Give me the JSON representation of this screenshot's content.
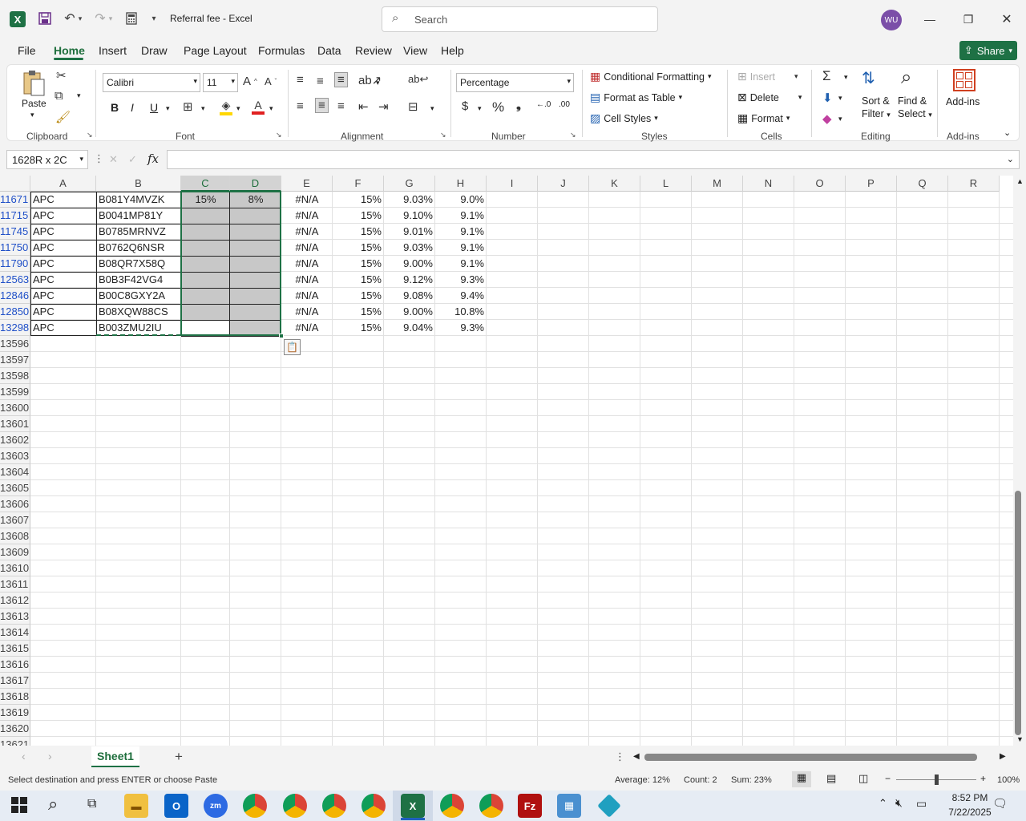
{
  "titlebar": {
    "title": "Referral fee  -  Excel",
    "search_placeholder": "Search",
    "avatar": "WU"
  },
  "tabs": [
    "File",
    "Home",
    "Insert",
    "Draw",
    "Page Layout",
    "Formulas",
    "Data",
    "Review",
    "View",
    "Help"
  ],
  "share_label": "Share",
  "ribbon": {
    "paste": "Paste",
    "clipboard": "Clipboard",
    "font_name": "Calibri",
    "font_size": "11",
    "font": "Font",
    "alignment": "Alignment",
    "number_format": "Percentage",
    "number": "Number",
    "conditional_formatting": "Conditional Formatting",
    "format_as_table": "Format as Table",
    "cell_styles": "Cell Styles",
    "styles": "Styles",
    "insert": "Insert",
    "delete": "Delete",
    "format": "Format",
    "cells": "Cells",
    "sort_filter_1": "Sort &",
    "sort_filter_2": "Filter",
    "find_select_1": "Find &",
    "find_select_2": "Select",
    "editing": "Editing",
    "addins": "Add-ins",
    "addins_group": "Add-ins",
    "bold": "B",
    "italic": "I",
    "underline": "U"
  },
  "formula_bar": {
    "name_box": "1628R x 2C",
    "fx": "fx",
    "value": ""
  },
  "grid": {
    "columns": [
      "A",
      "B",
      "C",
      "D",
      "E",
      "F",
      "G",
      "H",
      "I",
      "J",
      "K",
      "L",
      "M",
      "N",
      "O",
      "P",
      "Q",
      "R"
    ],
    "rows": [
      {
        "num": "11671",
        "a": "APC",
        "b": "B081Y4MVZK",
        "c": "15%",
        "d": "8%",
        "e": "#N/A",
        "f": "15%",
        "g": "9.03%",
        "h": "9.0%"
      },
      {
        "num": "11715",
        "a": "APC",
        "b": "B0041MP81Y",
        "c": "",
        "d": "",
        "e": "#N/A",
        "f": "15%",
        "g": "9.10%",
        "h": "9.1%"
      },
      {
        "num": "11745",
        "a": "APC",
        "b": "B0785MRNVZ",
        "c": "",
        "d": "",
        "e": "#N/A",
        "f": "15%",
        "g": "9.01%",
        "h": "9.1%"
      },
      {
        "num": "11750",
        "a": "APC",
        "b": "B0762Q6NSR",
        "c": "",
        "d": "",
        "e": "#N/A",
        "f": "15%",
        "g": "9.03%",
        "h": "9.1%"
      },
      {
        "num": "11790",
        "a": "APC",
        "b": "B08QR7X58Q",
        "c": "",
        "d": "",
        "e": "#N/A",
        "f": "15%",
        "g": "9.00%",
        "h": "9.1%"
      },
      {
        "num": "12563",
        "a": "APC",
        "b": "B0B3F42VG4",
        "c": "",
        "d": "",
        "e": "#N/A",
        "f": "15%",
        "g": "9.12%",
        "h": "9.3%"
      },
      {
        "num": "12846",
        "a": "APC",
        "b": "B00C8GXY2A",
        "c": "",
        "d": "",
        "e": "#N/A",
        "f": "15%",
        "g": "9.08%",
        "h": "9.4%"
      },
      {
        "num": "12850",
        "a": "APC",
        "b": "B08XQW88CS",
        "c": "",
        "d": "",
        "e": "#N/A",
        "f": "15%",
        "g": "9.00%",
        "h": "10.8%"
      },
      {
        "num": "13298",
        "a": "APC",
        "b": "B003ZMU2IU",
        "c": "",
        "d": "",
        "e": "#N/A",
        "f": "15%",
        "g": "9.04%",
        "h": "9.3%"
      }
    ],
    "empty_rows": [
      "13596",
      "13597",
      "13598",
      "13599",
      "13600",
      "13601",
      "13602",
      "13603",
      "13604",
      "13605",
      "13606",
      "13607",
      "13608",
      "13609",
      "13610",
      "13611",
      "13612",
      "13613",
      "13614",
      "13615",
      "13616",
      "13617",
      "13618",
      "13619",
      "13620",
      "13621"
    ]
  },
  "sheet_tab": "Sheet1",
  "status": {
    "message": "Select destination and press ENTER or choose Paste",
    "average": "Average: 12%",
    "count": "Count: 2",
    "sum": "Sum: 23%",
    "zoom": "100%"
  },
  "taskbar": {
    "time": "8:52 PM",
    "date": "7/22/2025"
  },
  "colors": {
    "excel_green": "#1e7145",
    "selection_gray": "#c8c8c8",
    "filtered_row_blue": "#2050c8"
  }
}
